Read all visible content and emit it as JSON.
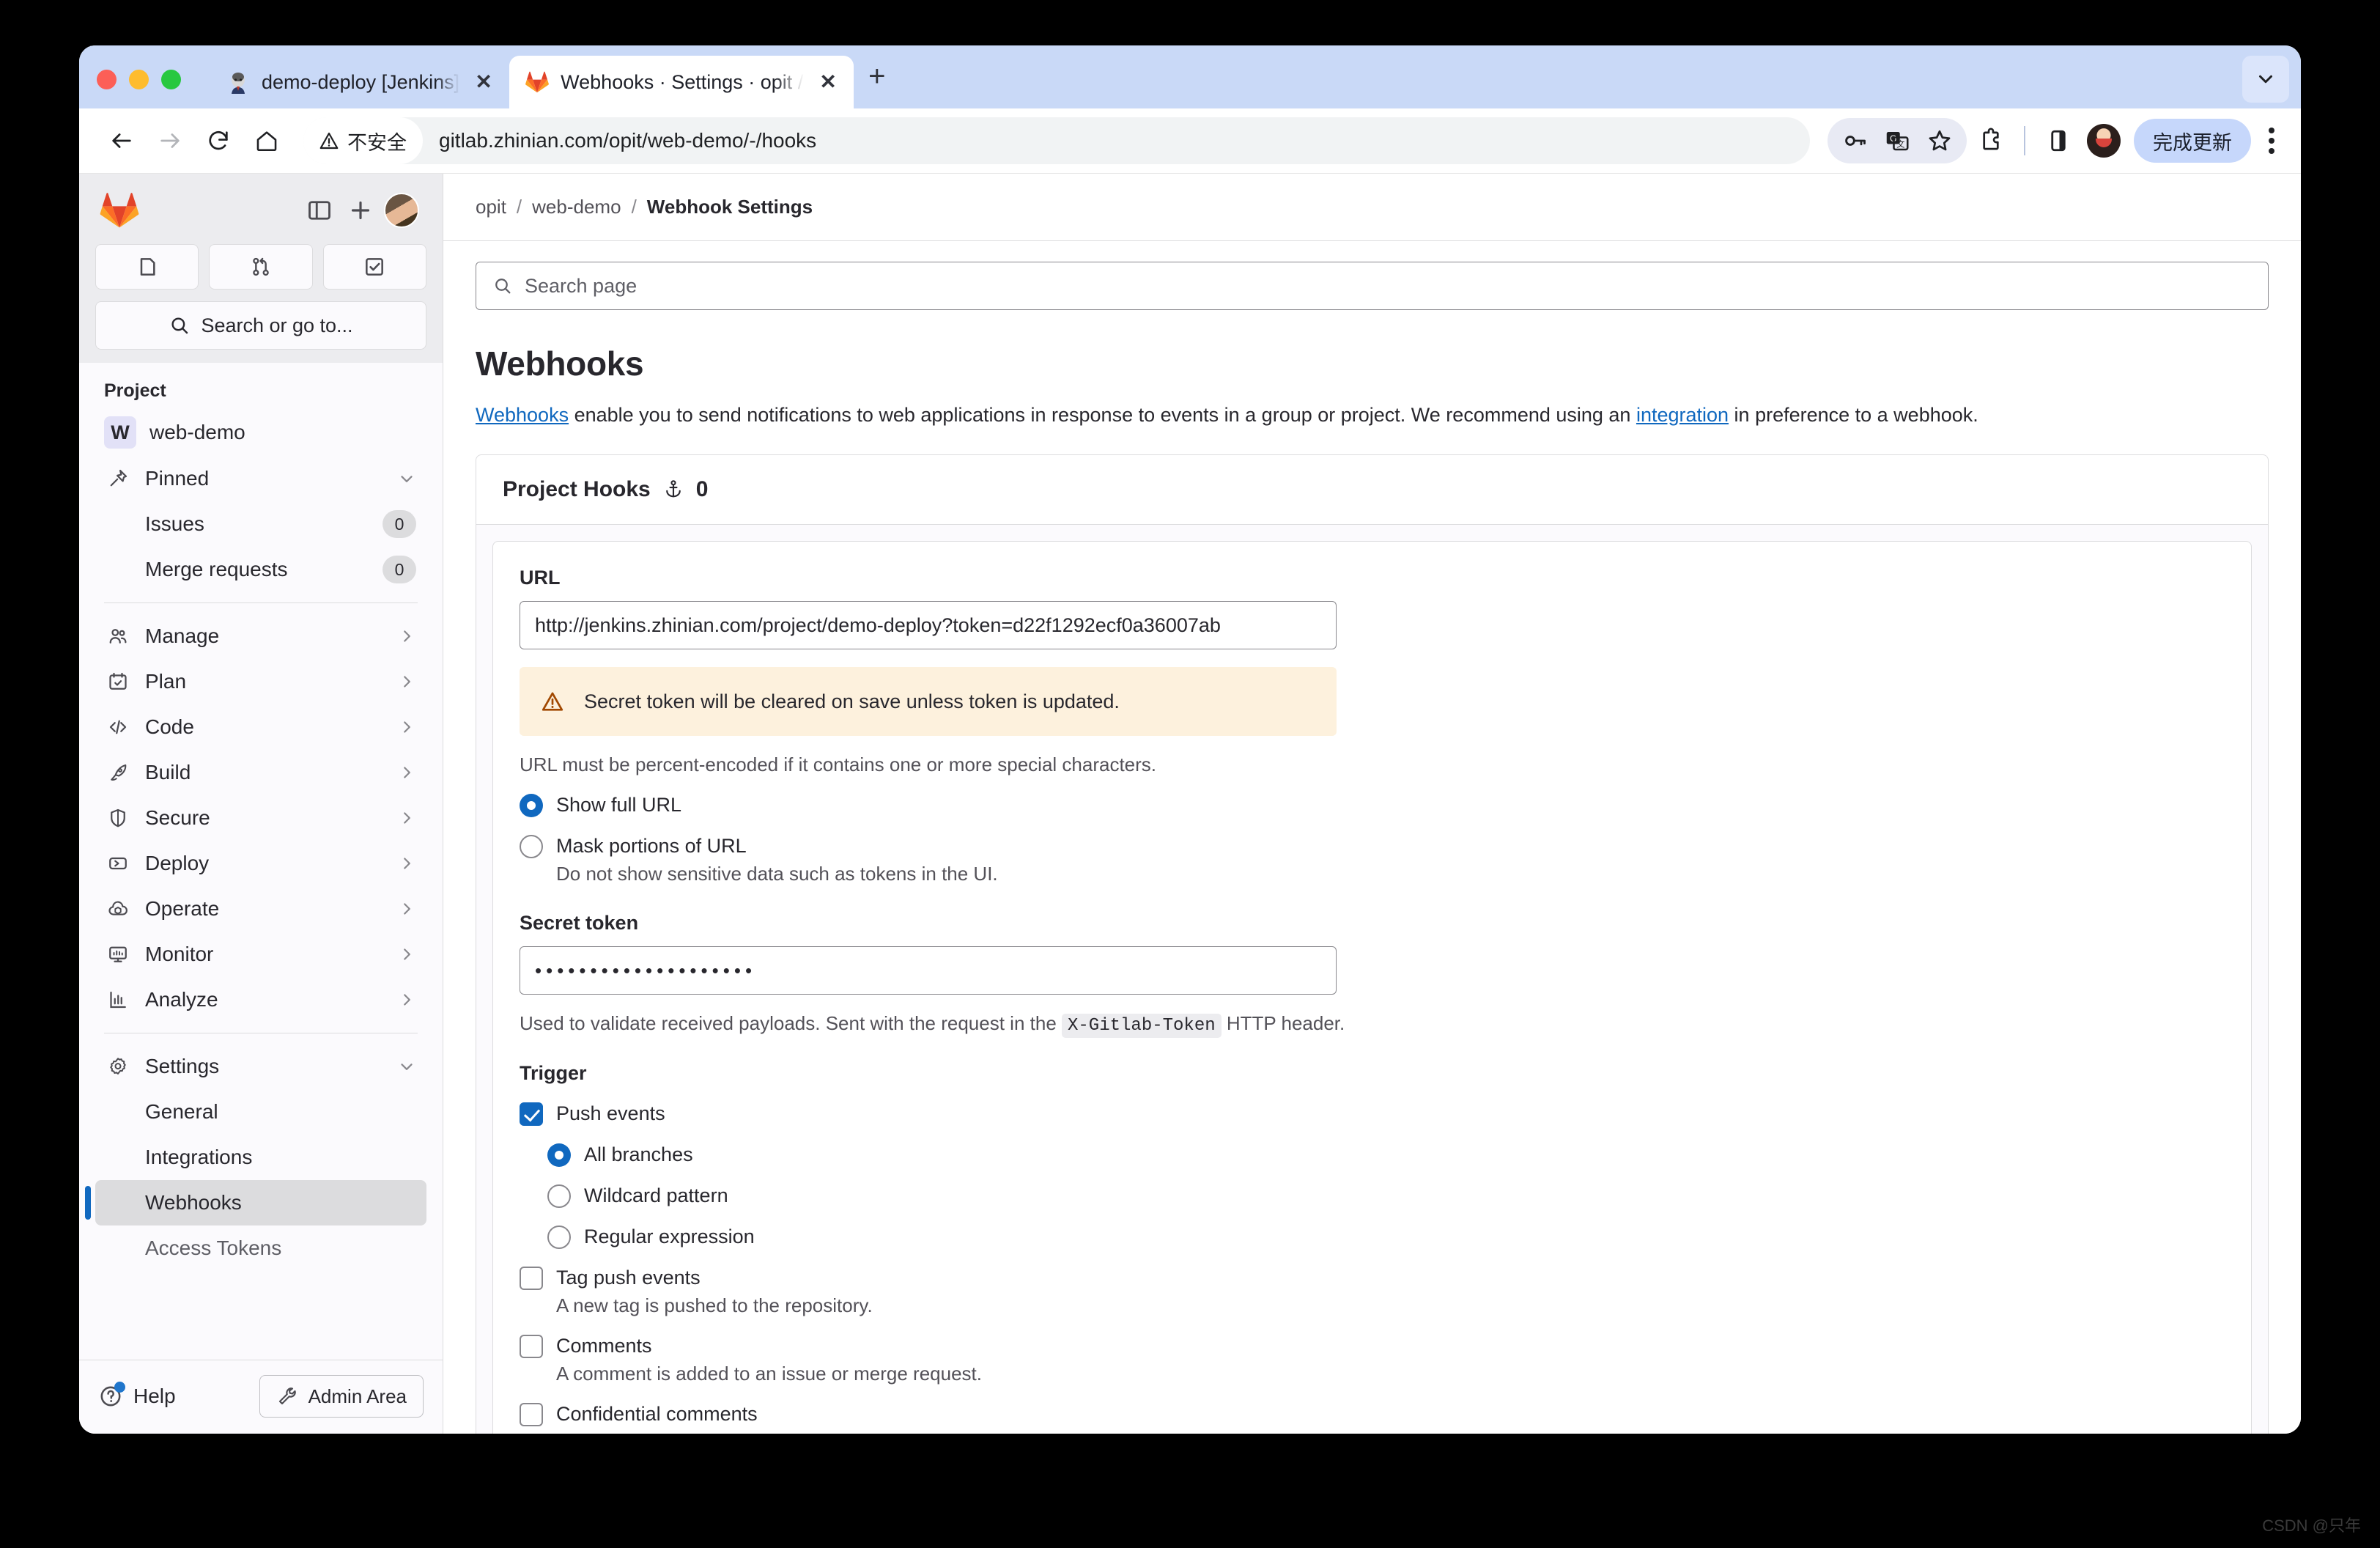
{
  "browser": {
    "tabs": [
      {
        "title": "demo-deploy [Jenkins]",
        "favicon": "jenkins-icon",
        "active": false
      },
      {
        "title": "Webhooks · Settings · opit / w",
        "favicon": "gitlab-icon",
        "active": true
      }
    ],
    "new_tab_label": "+",
    "tab_close_label": "✕",
    "toolbar": {
      "back_icon": "back-arrow-icon",
      "forward_icon": "forward-arrow-icon",
      "reload_icon": "reload-icon",
      "home_icon": "home-icon",
      "security_label": "不安全",
      "security_icon": "warning-triangle-icon",
      "url": "gitlab.zhinian.com/opit/web-demo/-/hooks",
      "icons": [
        "password-key-icon",
        "translate-icon",
        "bookmark-star-icon",
        "extensions-icon",
        "side-panel-icon"
      ],
      "profile_icon": "profile-avatar-icon",
      "update_label": "完成更新",
      "menu_icon": "kebab-menu-icon"
    }
  },
  "sidebar": {
    "logo": "gitlab-logo-icon",
    "collapse_icon": "sidebar-collapse-icon",
    "create_icon": "plus-icon",
    "user_avatar": "user-avatar",
    "quick_actions": [
      "issues-icon",
      "merge-requests-icon",
      "todos-icon"
    ],
    "search_placeholder": "Search or go to...",
    "search_icon": "search-icon",
    "section_label": "Project",
    "project": {
      "initial": "W",
      "name": "web-demo"
    },
    "items": [
      {
        "label": "Pinned",
        "icon": "pin-icon",
        "chevron": "down",
        "badge": null
      },
      {
        "label": "Issues",
        "icon": null,
        "sub": true,
        "badge": "0"
      },
      {
        "label": "Merge requests",
        "icon": null,
        "sub": true,
        "badge": "0"
      },
      {
        "label": "Manage",
        "icon": "users-icon",
        "chevron": "right"
      },
      {
        "label": "Plan",
        "icon": "calendar-icon",
        "chevron": "right"
      },
      {
        "label": "Code",
        "icon": "code-icon",
        "chevron": "right"
      },
      {
        "label": "Build",
        "icon": "rocket-icon",
        "chevron": "right"
      },
      {
        "label": "Secure",
        "icon": "shield-icon",
        "chevron": "right"
      },
      {
        "label": "Deploy",
        "icon": "deploy-icon",
        "chevron": "right"
      },
      {
        "label": "Operate",
        "icon": "cloud-cube-icon",
        "chevron": "right"
      },
      {
        "label": "Monitor",
        "icon": "monitor-icon",
        "chevron": "right"
      },
      {
        "label": "Analyze",
        "icon": "chart-icon",
        "chevron": "right"
      },
      {
        "label": "Settings",
        "icon": "gear-icon",
        "chevron": "down"
      },
      {
        "label": "General",
        "icon": null,
        "sub": true
      },
      {
        "label": "Integrations",
        "icon": null,
        "sub": true
      },
      {
        "label": "Webhooks",
        "icon": null,
        "sub": true,
        "active": true
      },
      {
        "label": "Access Tokens",
        "icon": null,
        "sub": true,
        "muted": true
      }
    ],
    "help_label": "Help",
    "help_icon": "question-circle-icon",
    "admin_label": "Admin Area",
    "admin_icon": "wrench-icon"
  },
  "breadcrumb": {
    "group": "opit",
    "project": "web-demo",
    "current": "Webhook Settings",
    "separator": "/"
  },
  "search_page": {
    "placeholder": "Search page",
    "icon": "search-icon"
  },
  "page": {
    "title": "Webhooks",
    "intro_link1": "Webhooks",
    "intro_mid": " enable you to send notifications to web applications in response to events in a group or project. We recommend using an ",
    "intro_link2": "integration",
    "intro_end": " in preference to a webhook."
  },
  "project_hooks": {
    "title": "Project Hooks",
    "hook_icon": "anchor-hook-icon",
    "count": "0"
  },
  "form": {
    "url_label": "URL",
    "url_value": "http://jenkins.zhinian.com/project/demo-deploy?token=d22f1292ecf0a36007ab",
    "alert_icon": "warning-triangle-icon",
    "alert_text": "Secret token will be cleared on save unless token is updated.",
    "url_helper": "URL must be percent-encoded if it contains one or more special characters.",
    "url_mode_options": [
      {
        "label": "Show full URL",
        "selected": true,
        "sub": null
      },
      {
        "label": "Mask portions of URL",
        "selected": false,
        "sub": "Do not show sensitive data such as tokens in the UI."
      }
    ],
    "secret_label": "Secret token",
    "secret_value": "••••••••••••••••••••",
    "secret_helper_pre": "Used to validate received payloads. Sent with the request in the ",
    "secret_helper_code": "X-Gitlab-Token",
    "secret_helper_post": " HTTP header.",
    "trigger_label": "Trigger",
    "triggers": [
      {
        "label": "Push events",
        "checked": true,
        "sub": null,
        "branch_options": [
          {
            "label": "All branches",
            "selected": true
          },
          {
            "label": "Wildcard pattern",
            "selected": false
          },
          {
            "label": "Regular expression",
            "selected": false
          }
        ]
      },
      {
        "label": "Tag push events",
        "checked": false,
        "sub": "A new tag is pushed to the repository."
      },
      {
        "label": "Comments",
        "checked": false,
        "sub": "A comment is added to an issue or merge request."
      },
      {
        "label": "Confidential comments",
        "checked": false,
        "sub": null
      }
    ]
  },
  "watermark": "CSDN @只年",
  "colors": {
    "accent": "#1068bf",
    "warning_bg": "#fdf1dd",
    "tabstrip": "#c9d9f7",
    "sidebar_bg": "#fbfafd"
  }
}
